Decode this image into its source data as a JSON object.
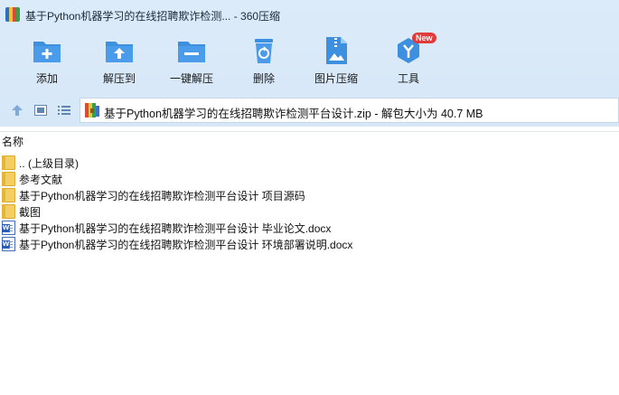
{
  "window": {
    "title": "基于Python机器学习的在线招聘欺诈检测... - 360压缩"
  },
  "toolbar": {
    "items": [
      {
        "label": "添加",
        "icon": "add-folder-icon"
      },
      {
        "label": "解压到",
        "icon": "extract-folder-icon"
      },
      {
        "label": "一键解压",
        "icon": "one-click-extract-icon"
      },
      {
        "label": "删除",
        "icon": "trash-icon"
      },
      {
        "label": "图片压缩",
        "icon": "image-compress-icon"
      },
      {
        "label": "工具",
        "icon": "tools-icon",
        "badge": "New"
      }
    ]
  },
  "nav": {
    "address": "基于Python机器学习的在线招聘欺诈检测平台设计.zip - 解包大小为 40.7 MB"
  },
  "file_list": {
    "column_header": "名称",
    "rows": [
      {
        "name": ".. (上级目录)",
        "type": "folder"
      },
      {
        "name": "参考文献",
        "type": "folder"
      },
      {
        "name": "基于Python机器学习的在线招聘欺诈检测平台设计 项目源码",
        "type": "folder"
      },
      {
        "name": "截图",
        "type": "folder"
      },
      {
        "name": "基于Python机器学习的在线招聘欺诈检测平台设计 毕业论文.docx",
        "type": "docx"
      },
      {
        "name": "基于Python机器学习的在线招聘欺诈检测平台设计 环境部署说明.docx",
        "type": "docx"
      }
    ]
  },
  "colors": {
    "toolbar_blue": "#3d8fe0",
    "folder_yellow": "#f3cf63",
    "badge_red": "#e23b3b"
  }
}
